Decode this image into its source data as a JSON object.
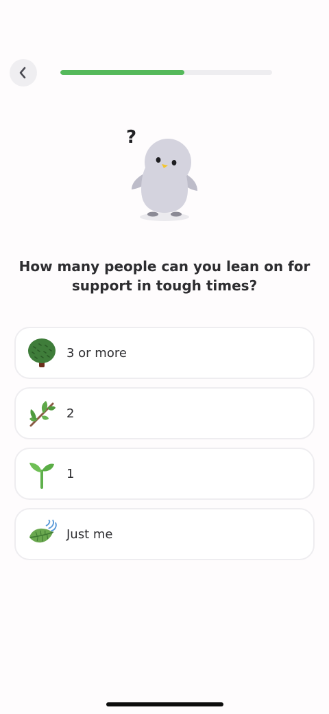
{
  "header": {
    "back_icon": "chevron-left-icon",
    "progress": 0.585,
    "progress_color": "#55b95b"
  },
  "mascot": {
    "icon": "penguin-mascot",
    "question_mark": "?"
  },
  "question": "How many people can you lean on for support in tough times?",
  "options": [
    {
      "label": "3 or more",
      "icon": "tree-icon"
    },
    {
      "label": "2",
      "icon": "branch-icon"
    },
    {
      "label": "1",
      "icon": "sprout-icon"
    },
    {
      "label": "Just me",
      "icon": "leaf-wind-icon"
    }
  ]
}
